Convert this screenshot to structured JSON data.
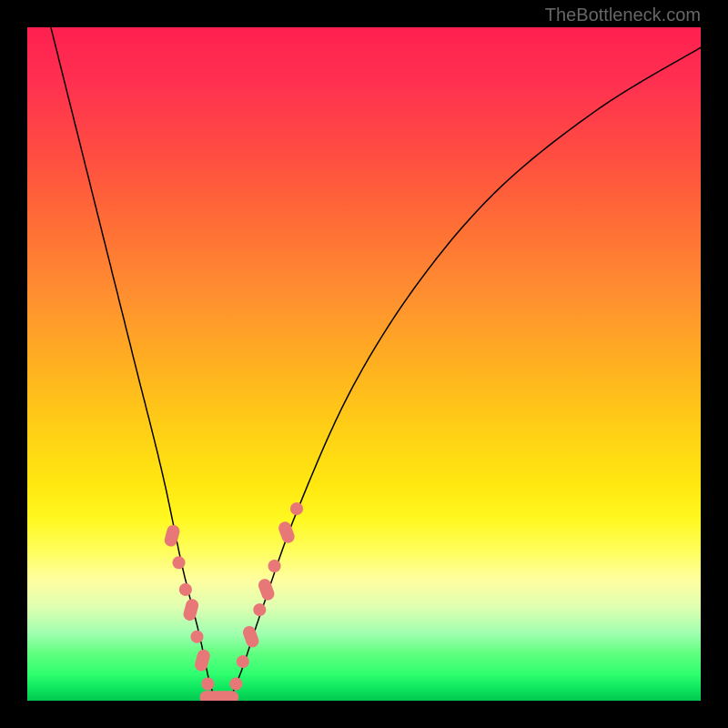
{
  "watermark": "TheBottleneck.com",
  "chart_data": {
    "type": "line",
    "title": "",
    "xlabel": "",
    "ylabel": "",
    "xlim": [
      0,
      1
    ],
    "ylim": [
      0,
      1
    ],
    "curve_left": {
      "x": [
        0.035,
        0.08,
        0.12,
        0.16,
        0.2,
        0.23,
        0.255,
        0.27,
        0.28
      ],
      "y": [
        1.0,
        0.82,
        0.66,
        0.5,
        0.34,
        0.2,
        0.1,
        0.03,
        0.0
      ]
    },
    "curve_right": {
      "x": [
        0.3,
        0.32,
        0.35,
        0.4,
        0.48,
        0.58,
        0.7,
        0.85,
        1.0
      ],
      "y": [
        0.0,
        0.05,
        0.14,
        0.28,
        0.46,
        0.62,
        0.76,
        0.88,
        0.97
      ]
    },
    "markers_left": [
      {
        "x": 0.215,
        "y": 0.245,
        "type": "pill"
      },
      {
        "x": 0.225,
        "y": 0.205,
        "type": "circle"
      },
      {
        "x": 0.235,
        "y": 0.165,
        "type": "circle"
      },
      {
        "x": 0.243,
        "y": 0.135,
        "type": "pill"
      },
      {
        "x": 0.252,
        "y": 0.095,
        "type": "circle"
      },
      {
        "x": 0.26,
        "y": 0.06,
        "type": "pill"
      },
      {
        "x": 0.268,
        "y": 0.025,
        "type": "circle"
      }
    ],
    "markers_bottom": [
      {
        "x": 0.275,
        "y": 0.005,
        "type": "pill_h"
      },
      {
        "x": 0.295,
        "y": 0.005,
        "type": "pill_h"
      }
    ],
    "markers_right": [
      {
        "x": 0.31,
        "y": 0.025,
        "type": "circle"
      },
      {
        "x": 0.32,
        "y": 0.058,
        "type": "circle"
      },
      {
        "x": 0.332,
        "y": 0.095,
        "type": "pill"
      },
      {
        "x": 0.345,
        "y": 0.135,
        "type": "circle"
      },
      {
        "x": 0.355,
        "y": 0.165,
        "type": "pill"
      },
      {
        "x": 0.367,
        "y": 0.2,
        "type": "circle"
      },
      {
        "x": 0.385,
        "y": 0.25,
        "type": "pill"
      },
      {
        "x": 0.4,
        "y": 0.285,
        "type": "circle"
      }
    ]
  }
}
